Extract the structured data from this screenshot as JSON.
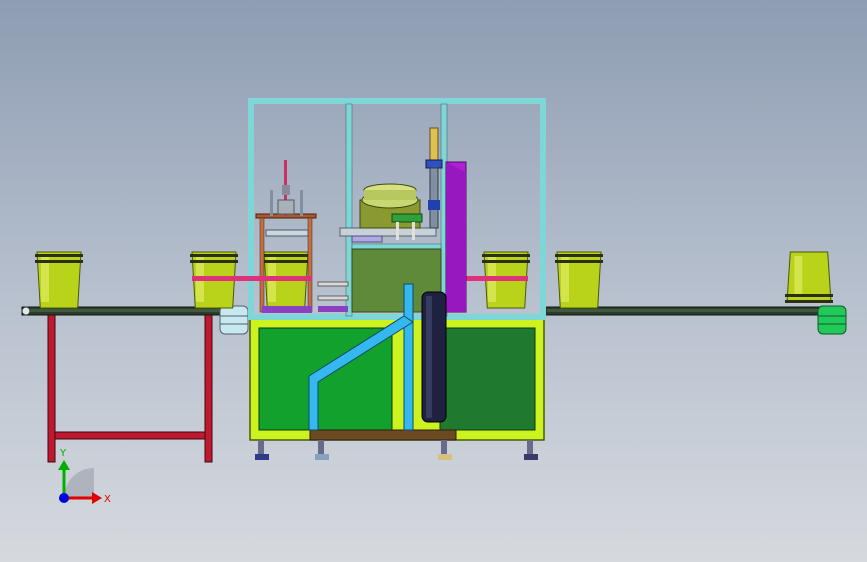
{
  "viewport": {
    "background_top": "#8e9db3",
    "background_bottom": "#d6d9de"
  },
  "model": {
    "frame_color": "#7fd6d6",
    "base_color": "#ccf21f",
    "base_panel_color": "#0f8f2a",
    "base_panel_color_2": "#1f7a2f",
    "pipe_color": "#35b8f0",
    "purple_color": "#b020d8",
    "bucket_color": "#b9d21a",
    "leg_color": "#c0182f",
    "conveyor_end_left_color": "#c8e8f0",
    "conveyor_end_right_color": "#22c95a"
  },
  "triad": {
    "x_label": "X",
    "y_label": "Y",
    "x_color": "#e00000",
    "y_color": "#00b000",
    "z_color": "#0000e0"
  }
}
